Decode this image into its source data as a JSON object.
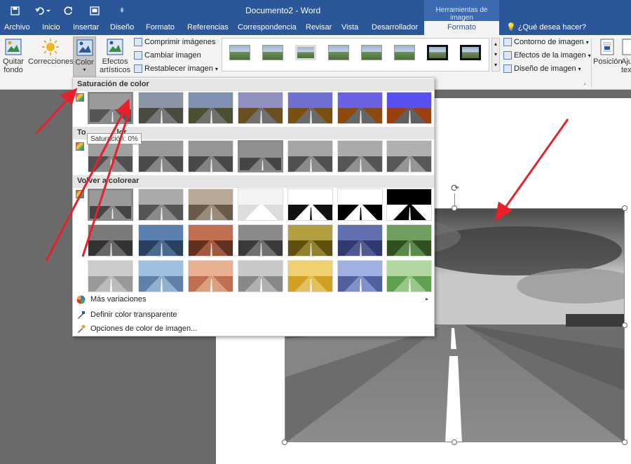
{
  "titlebar": {
    "title": "Documento2 - Word",
    "context_group": "Herramientas de imagen",
    "qat_more": "ǂ"
  },
  "tabs": [
    "Archivo",
    "Inicio",
    "Insertar",
    "Diseño",
    "Formato",
    "Referencias",
    "Correspondencia",
    "Revisar",
    "Vista",
    "Desarrollador"
  ],
  "active_tab": "Formato",
  "tell_me": "¿Qué desea hacer?",
  "ribbon": {
    "quitar_fondo": [
      "Quitar",
      "fondo"
    ],
    "correcciones": "Correcciones",
    "color": "Color",
    "efectos": [
      "Efectos",
      "artísticos"
    ],
    "comprimir": "Comprimir imágenes",
    "cambiar": "Cambiar imagen",
    "restablecer": "Restablecer imagen",
    "contorno": "Contorno de imagen",
    "efectos_imagen": "Efectos de la imagen",
    "diseno": "Diseño de imagen",
    "posicion": "Posición",
    "ajustar_partial": "Aju",
    "ajustar_partial2": "tex"
  },
  "menu": {
    "sat_header": "Saturación de color",
    "tone_header_left": "To",
    "tone_header_right": "lor",
    "recolor_header": "Volver a colorear",
    "tooltip": "Saturación: 0%",
    "mas_variaciones": "Más variaciones",
    "definir_transparente": "Definir color transparente",
    "opciones_color": "Opciones de color de imagen..."
  },
  "colors": {
    "word_blue": "#2b579a",
    "arrow_red": "#e8202a",
    "ribbon_bg": "#f3f3f3"
  }
}
